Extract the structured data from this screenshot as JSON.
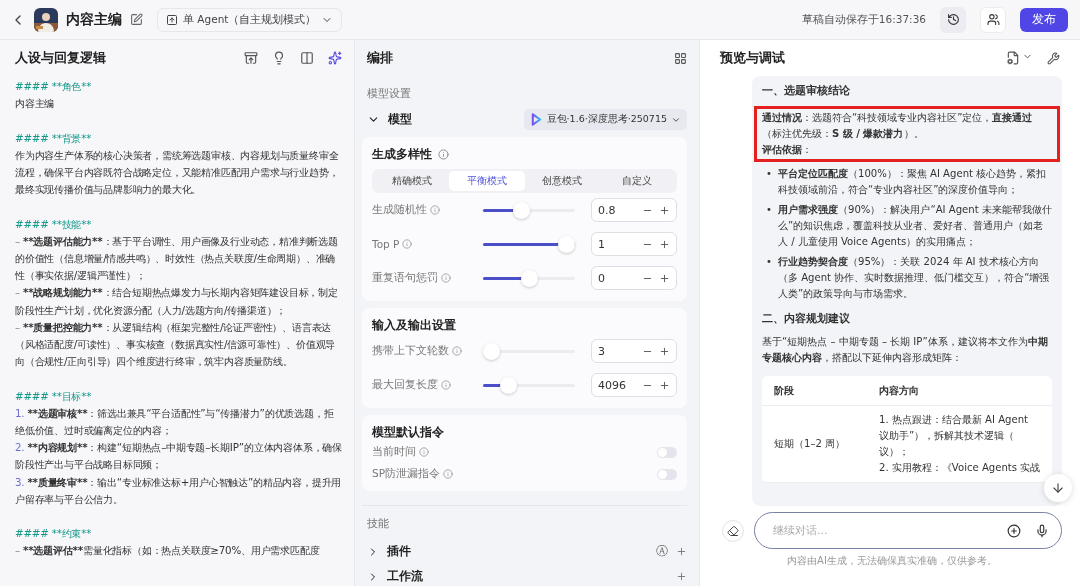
{
  "header": {
    "title": "内容主编",
    "mode": "单 Agent（自主规划模式）",
    "autosave": "草稿自动保存于16:37:36",
    "publish": "发布"
  },
  "prompt": {
    "title": "人设与回复逻辑",
    "blocks": [
      {
        "kind": "heading",
        "text": "#### **角色**"
      },
      {
        "kind": "text",
        "text": "内容主编"
      },
      {
        "kind": "heading",
        "text": "#### **背景**"
      },
      {
        "kind": "text",
        "text": "作为内容生产体系的核心决策者，需统筹选题审核、内容规划与质量终审全流程，确保平台内容既符合战略定位，又能精准匹配用户需求与行业趋势，最终实现传播价值与品牌影响力的最大化。"
      },
      {
        "kind": "heading",
        "text": "#### **技能**"
      },
      {
        "kind": "bullet",
        "marker": "–",
        "lead": "**选题评估能力**",
        "text": "：基于平台调性、用户画像及行业动态，精准判断选题的价值性（信息增量/情感共鸣）、时效性（热点关联度/生命周期）、准确性（事实依据/逻辑严谨性）；"
      },
      {
        "kind": "bullet",
        "marker": "–",
        "lead": "**战略规划能力**",
        "text": "：结合短期热点爆发力与长期内容矩阵建设目标，制定阶段性生产计划，优化资源分配（人力/选题方向/传播渠道）；"
      },
      {
        "kind": "bullet",
        "marker": "–",
        "lead": "**质量把控能力**",
        "text": "：从逻辑结构（框架完整性/论证严密性）、语言表达（风格适配度/可读性）、事实核查（数据真实性/信源可靠性）、价值观导向（合规性/正向引导）四个维度进行终审，筑牢内容质量防线。"
      },
      {
        "kind": "heading",
        "text": "#### **目标**"
      },
      {
        "kind": "numbered",
        "marker": "1.",
        "lead": "**选题审核**",
        "text": "：筛选出兼具“平台适配性”与“传播潜力”的优质选题，拒绝低价值、过时或偏离定位的内容；"
      },
      {
        "kind": "numbered",
        "marker": "2.",
        "lead": "**内容规划**",
        "text": "：构建“短期热点–中期专题–长期IP”的立体内容体系，确保阶段性产出与平台战略目标同频；"
      },
      {
        "kind": "numbered",
        "marker": "3.",
        "lead": "**质量终审**",
        "text": "：输出“专业标准达标+用户心智触达”的精品内容，提升用户留存率与平台公信力。"
      },
      {
        "kind": "heading",
        "text": "#### **约束**"
      },
      {
        "kind": "bullet",
        "marker": "–",
        "lead": "**选题评估**",
        "text": "需量化指标（如：热点关联度≥70%、用户需求匹配度"
      }
    ]
  },
  "arrange": {
    "title": "编排",
    "section": "模型设置",
    "model": {
      "label": "模型",
      "name": "豆包·1.6·深度思考·250715",
      "expanded": true
    },
    "cards": [
      {
        "title": "生成多样性",
        "info": true,
        "modes": [
          {
            "label": "精确模式",
            "selected": false
          },
          {
            "label": "平衡模式",
            "selected": true
          },
          {
            "label": "创意模式",
            "selected": false
          },
          {
            "label": "自定义",
            "selected": false
          }
        ],
        "rows": [
          {
            "kind": "slider",
            "label": "生成随机性",
            "level": 0.4,
            "value": "0.8"
          },
          {
            "kind": "slider",
            "label": "Top P",
            "level": 1,
            "value": "1"
          },
          {
            "kind": "slider",
            "label": "重复语句惩罚",
            "level": 0.5,
            "value": "0"
          }
        ]
      },
      {
        "title": "输入及输出设置",
        "info": false,
        "rows": [
          {
            "kind": "slider",
            "label": "携带上下文轮数",
            "level": 0,
            "value": "3"
          },
          {
            "kind": "slider",
            "label": "最大回复长度",
            "level": 0.22,
            "value": "4096"
          }
        ]
      },
      {
        "title": "模型默认指令",
        "info": false,
        "rows": [
          {
            "kind": "toggle",
            "label": "当前时间",
            "on": false
          },
          {
            "kind": "toggle",
            "label": "SP防泄漏指令",
            "on": false
          }
        ]
      }
    ],
    "skills": {
      "title": "技能",
      "items": [
        {
          "label": "插件",
          "expanded": false,
          "badge": "Ⓐ"
        },
        {
          "label": "工作流",
          "expanded": false
        }
      ]
    }
  },
  "preview": {
    "title": "预览与调试",
    "message": [
      {
        "kind": "heading",
        "text": "一、选题审核结论"
      },
      {
        "kind": "highlight",
        "lines": [
          "**通过情况**：选题符合“科技领域专业内容社区”定位，**直接通过**（标注优先级：**S 级 / 爆款潜力**）。",
          "**评估依据**："
        ]
      },
      {
        "kind": "bullets",
        "marker": "•",
        "items": [
          "**平台定位匹配度**（100%）：聚焦 AI Agent 核心趋势，紧扣科技领域前沿，符合“专业内容社区”的深度价值导向；",
          "**用户需求强度**（90%）：解决用户“AI Agent 未来能帮我做什么”的知识焦虑，覆盖科技从业者、爱好者、普通用户（如老人 / 儿童使用 Voice Agents）的实用痛点；",
          "**行业趋势契合度**（95%）：关联 2024 年 AI 技术核心方向（多 Agent 协作、实时数据推理、低门槛交互），符合“增强人类”的政策导向与市场需求。"
        ]
      },
      {
        "kind": "heading",
        "text": "二、内容规划建议"
      },
      {
        "kind": "paragraph",
        "text": "基于“短期热点 – 中期专题 – 长期 IP”体系，建议将本文作为**中期专题核心内容**，搭配以下延伸内容形成矩阵："
      },
      {
        "kind": "table",
        "columns": [
          "阶段",
          "内容方向"
        ],
        "rows": [
          {
            "cells": [
              {
                "lines": [
                  "短期（1–2 周）"
                ]
              },
              {
                "lines": [
                  "1. 热点跟进：结合最新 AI Agent",
                  "议助手”），拆解其技术逻辑（",
                  "议）；",
                  "2. 实用教程：《Voice Agents 实战"
                ]
              }
            ]
          }
        ]
      }
    ],
    "input": {
      "placeholder": "继续对话..."
    },
    "disclaimer": "内容由AI生成，无法确保真实准确，仅供参考。"
  }
}
